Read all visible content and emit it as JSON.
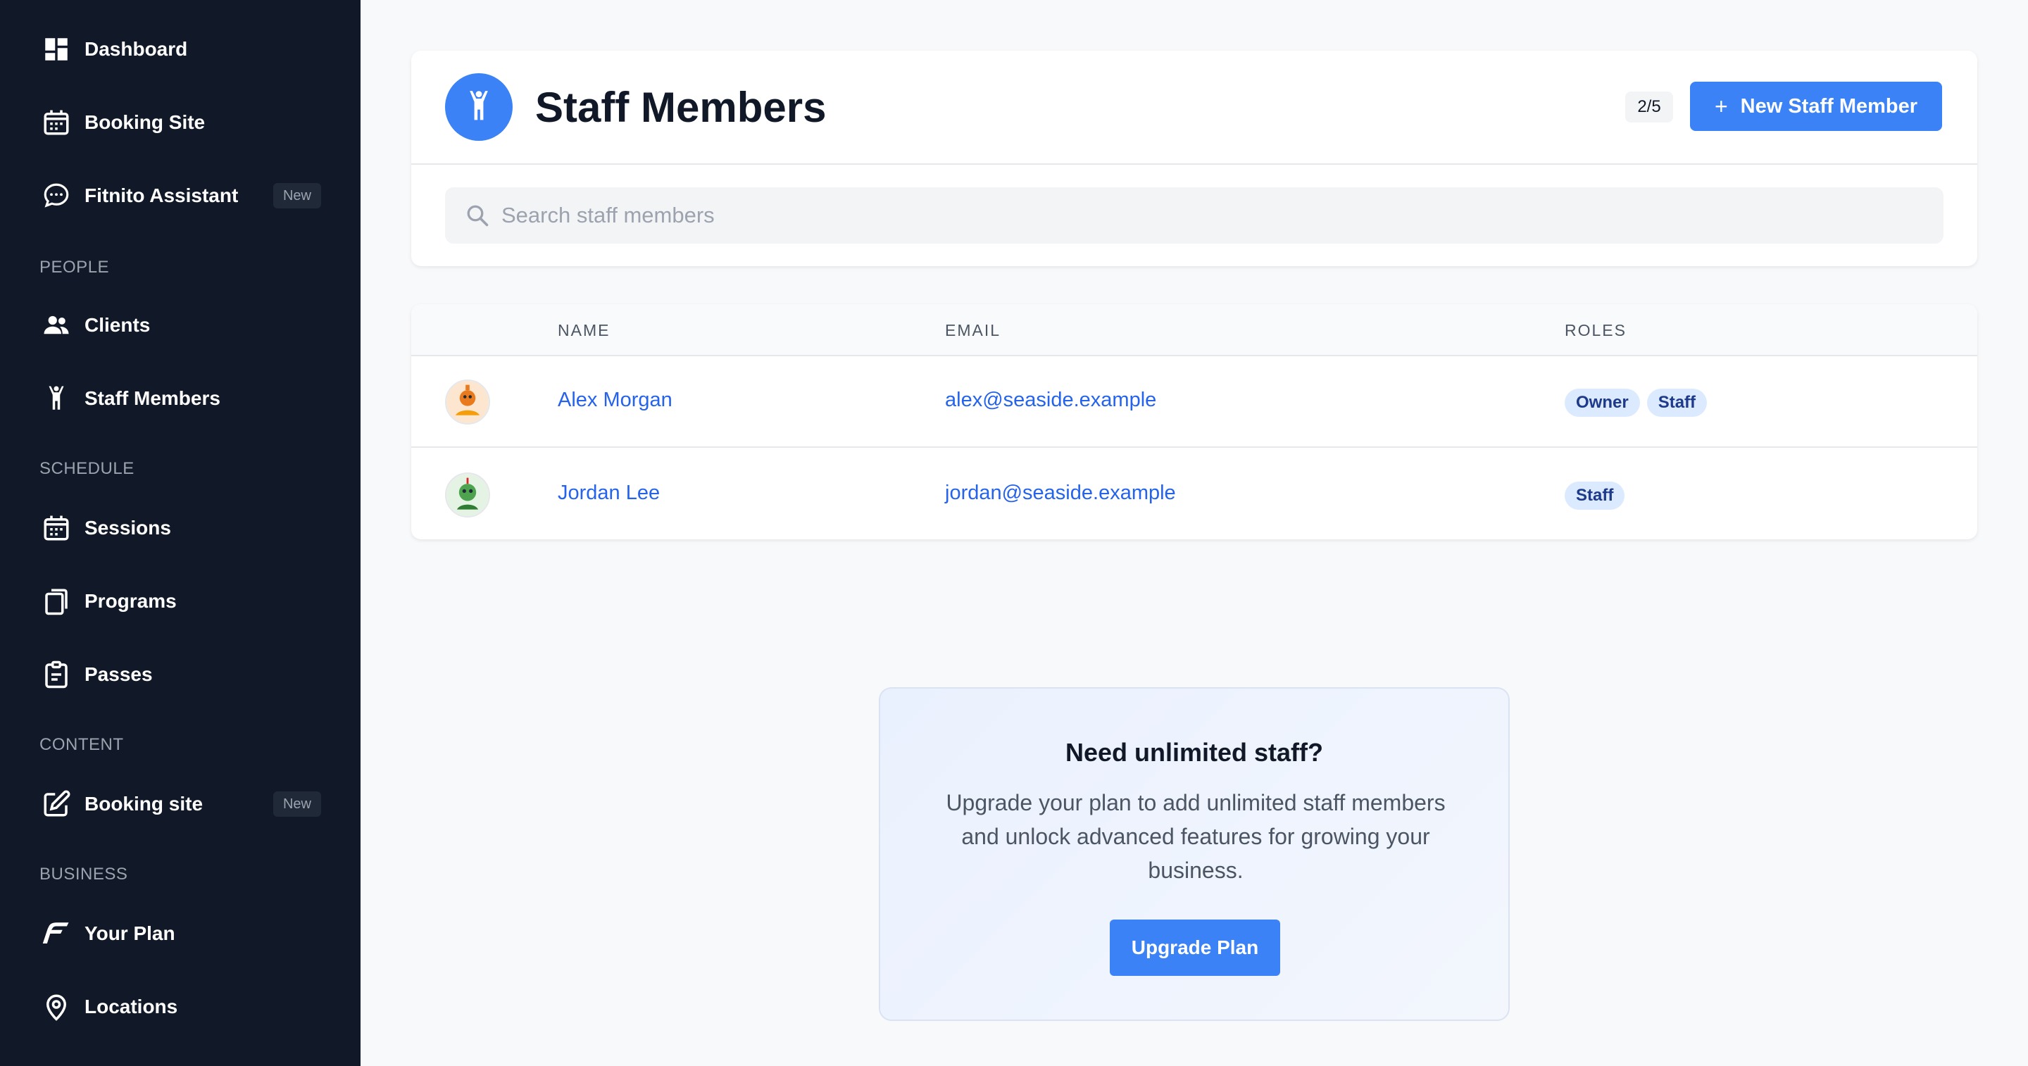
{
  "sidebar": {
    "top_items": [
      {
        "label": "Dashboard",
        "icon": "dashboard-icon"
      },
      {
        "label": "Booking Site",
        "icon": "calendar-icon"
      },
      {
        "label": "Fitnito Assistant",
        "icon": "chat-icon",
        "badge": "New"
      }
    ],
    "sections": {
      "people": {
        "label": "PEOPLE",
        "items": [
          {
            "label": "Clients",
            "icon": "users-icon"
          },
          {
            "label": "Staff Members",
            "icon": "person-arms-up-icon"
          }
        ]
      },
      "schedule": {
        "label": "SCHEDULE",
        "items": [
          {
            "label": "Sessions",
            "icon": "calendar-icon"
          },
          {
            "label": "Programs",
            "icon": "clipboard-copy-icon"
          },
          {
            "label": "Passes",
            "icon": "clipboard-icon"
          }
        ]
      },
      "content": {
        "label": "CONTENT",
        "items": [
          {
            "label": "Booking site",
            "icon": "edit-icon",
            "badge": "New"
          }
        ]
      },
      "business": {
        "label": "BUSINESS",
        "items": [
          {
            "label": "Your Plan",
            "icon": "brand-f-icon"
          },
          {
            "label": "Locations",
            "icon": "location-pin-icon"
          }
        ]
      }
    }
  },
  "header": {
    "title": "Staff Members",
    "count": "2/5",
    "new_button": {
      "plus": "+",
      "label": "New Staff Member"
    },
    "search_placeholder": "Search staff members"
  },
  "table": {
    "columns": [
      "NAME",
      "EMAIL",
      "ROLES"
    ],
    "rows": [
      {
        "name": "Alex Morgan",
        "email": "alex@seaside.example",
        "roles": [
          "Owner",
          "Staff"
        ]
      },
      {
        "name": "Jordan Lee",
        "email": "jordan@seaside.example",
        "roles": [
          "Staff"
        ]
      }
    ]
  },
  "upgrade": {
    "title": "Need unlimited staff?",
    "text": "Upgrade your plan to add unlimited staff members and unlock advanced features for growing your business.",
    "button": "Upgrade Plan"
  },
  "colors": {
    "sidebar_bg": "#111827",
    "accent": "#3b82f6",
    "link": "#2563eb",
    "role_bg": "#dbeafe"
  }
}
